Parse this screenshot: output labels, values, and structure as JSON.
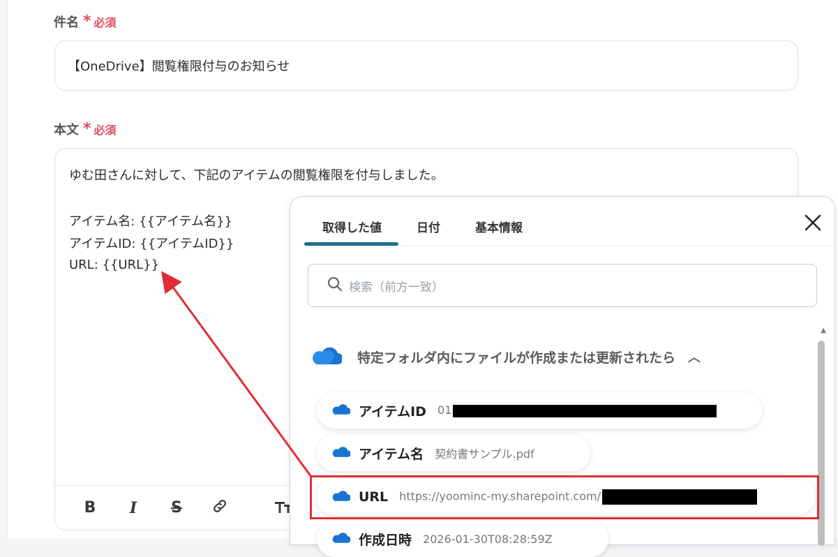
{
  "form": {
    "subject": {
      "label": "件名",
      "required_mark": "*",
      "required_text": "必須",
      "value": "【OneDrive】閲覧権限付与のお知らせ"
    },
    "body": {
      "label": "本文",
      "required_mark": "*",
      "required_text": "必須",
      "lines": [
        "ゆむ田さんに対して、下記のアイテムの閲覧権限を付与しました。",
        "アイテム名: {{アイテム名}}",
        "アイテムID: {{アイテムID}}",
        "URL: {{URL}}"
      ]
    },
    "toolbar": [
      "B",
      "I",
      "S",
      "link",
      "TT"
    ]
  },
  "popup": {
    "tabs": [
      "取得した値",
      "日付",
      "基本情報"
    ],
    "active_tab": "取得した値",
    "search_placeholder": "検索（前方一致）",
    "section_title": "特定フォルダ内にファイルが作成または更新されたら",
    "items": [
      {
        "name": "アイテムID",
        "value": "01"
      },
      {
        "name": "アイテム名",
        "value": "契約書サンプル.pdf"
      },
      {
        "name": "URL",
        "value": "https://yoominc-my.sharepoint.com/"
      },
      {
        "name": "作成日時",
        "value": "2026-01-30T08:28:59Z"
      }
    ],
    "highlighted_item": "URL"
  },
  "colors": {
    "required": "#e04b5c",
    "active_tab_underline": "#1f6f8b",
    "highlight_border": "#e02d38",
    "onedrive_blue": "#1a73d1"
  }
}
